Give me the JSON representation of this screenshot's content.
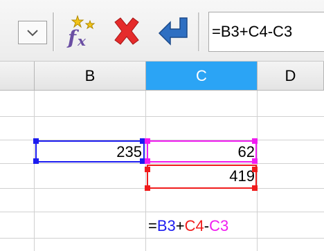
{
  "formula_bar": {
    "formula": "=B3+C4-C3"
  },
  "columns": [
    {
      "label": "B",
      "active": false
    },
    {
      "label": "C",
      "active": true
    },
    {
      "label": "D",
      "active": false
    }
  ],
  "cells": {
    "B3": "235",
    "C3": "62",
    "C4": "419"
  },
  "edit_cell": {
    "prefix": "=",
    "ref1": "B3",
    "op1": "+",
    "ref2": "C4",
    "op2": "-",
    "ref3": "C3"
  },
  "colors": {
    "ref1": "#1c1cf0",
    "ref2": "#f01c1c",
    "ref3": "#f01cf0",
    "active_column": "#2ba4f5"
  },
  "icons": [
    "chevron-down-icon",
    "function-wizard-icon",
    "cancel-icon",
    "accept-icon"
  ]
}
